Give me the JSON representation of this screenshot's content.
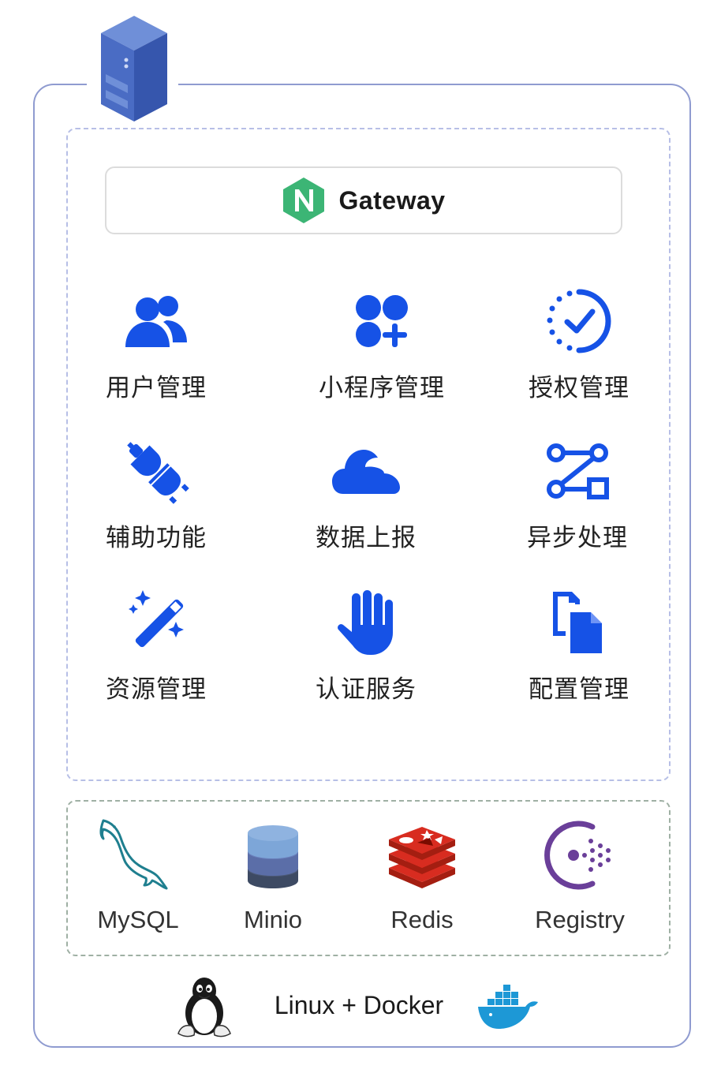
{
  "colors": {
    "frame": "#8f9bd0",
    "services_border": "#b7bfe6",
    "infra_border": "#9fb0a4",
    "service_icon": "#1652e6",
    "nginx_green": "#3cb575",
    "mysql_teal": "#1f7f8f",
    "redis_red": "#c9302c",
    "registry_purple": "#6a3f99",
    "docker_blue": "#1d98d6"
  },
  "server": {
    "icon": "server-rack-icon"
  },
  "gateway": {
    "label": "Gateway",
    "icon": "nginx-icon"
  },
  "services": [
    {
      "label": "用户管理",
      "icon": "users-icon"
    },
    {
      "label": "小程序管理",
      "icon": "apps-add-icon"
    },
    {
      "label": "授权管理",
      "icon": "circle-check-icon"
    },
    {
      "label": "辅助功能",
      "icon": "plug-icon"
    },
    {
      "label": "数据上报",
      "icon": "cloud-icon"
    },
    {
      "label": "异步处理",
      "icon": "flow-icon"
    },
    {
      "label": "资源管理",
      "icon": "magic-wand-icon"
    },
    {
      "label": "认证服务",
      "icon": "hand-icon"
    },
    {
      "label": "配置管理",
      "icon": "files-icon"
    }
  ],
  "infra": [
    {
      "label": "MySQL",
      "icon": "dolphin-icon"
    },
    {
      "label": "Minio",
      "icon": "database-stack-icon"
    },
    {
      "label": "Redis",
      "icon": "redis-icon"
    },
    {
      "label": "Registry",
      "icon": "consul-icon"
    }
  ],
  "runtime": {
    "label": "Linux + Docker",
    "left_icon": "tux-icon",
    "right_icon": "docker-whale-icon"
  }
}
